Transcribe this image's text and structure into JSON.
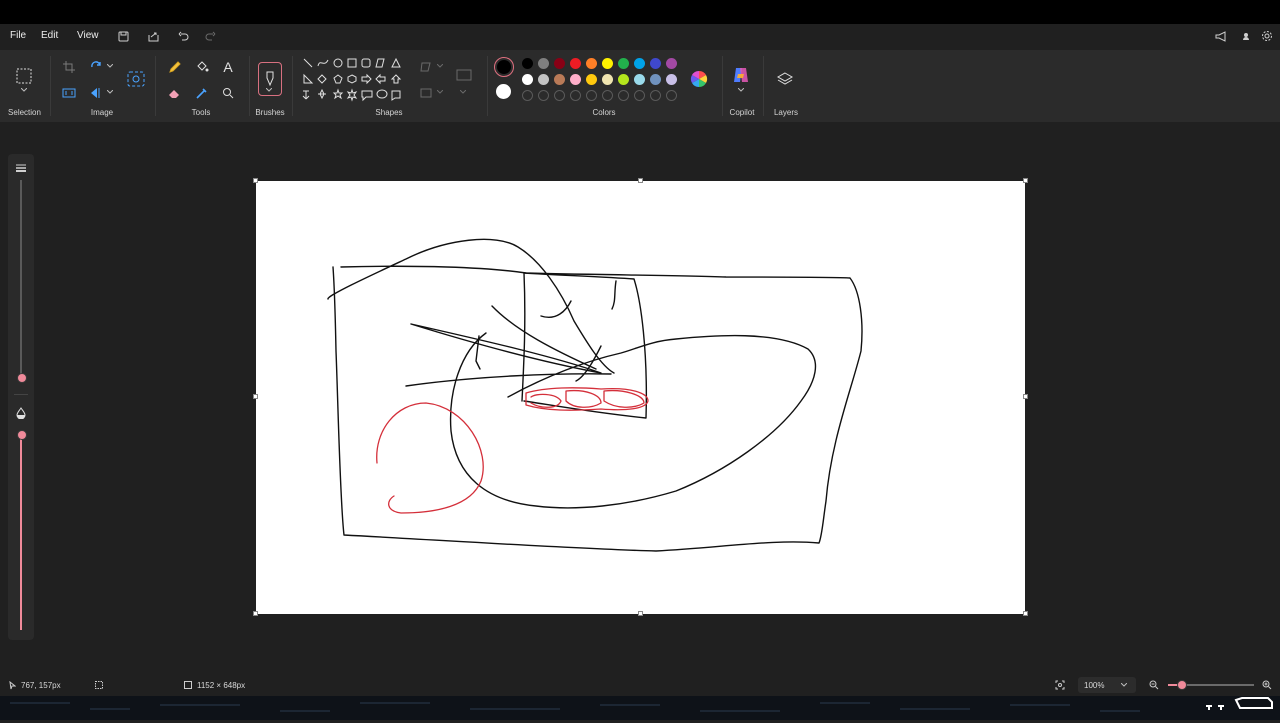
{
  "menu": {
    "file": "File",
    "edit": "Edit",
    "view": "View"
  },
  "ribbon": {
    "selection_label": "Selection",
    "image_label": "Image",
    "tools_label": "Tools",
    "brushes_label": "Brushes",
    "shapes_label": "Shapes",
    "colors_label": "Colors",
    "copilot_label": "Copilot",
    "layers_label": "Layers",
    "text_tool_glyph": "A"
  },
  "colors": {
    "primary": "#000000",
    "secondary": "#ffffff",
    "row1": [
      "#000000",
      "#7f7f7f",
      "#880015",
      "#ed1c24",
      "#ff7f27",
      "#fff200",
      "#22b14c",
      "#00a2e8",
      "#3f48cc",
      "#a349a4"
    ],
    "row2": [
      "#ffffff",
      "#c3c3c3",
      "#b97a57",
      "#ffaec9",
      "#ffc90e",
      "#efe4b0",
      "#b5e61d",
      "#99d9ea",
      "#7092be",
      "#c8bfe7"
    ]
  },
  "status": {
    "cursor_position": "767, 157px",
    "canvas_size": "1152 × 648px",
    "zoom": "100%"
  }
}
